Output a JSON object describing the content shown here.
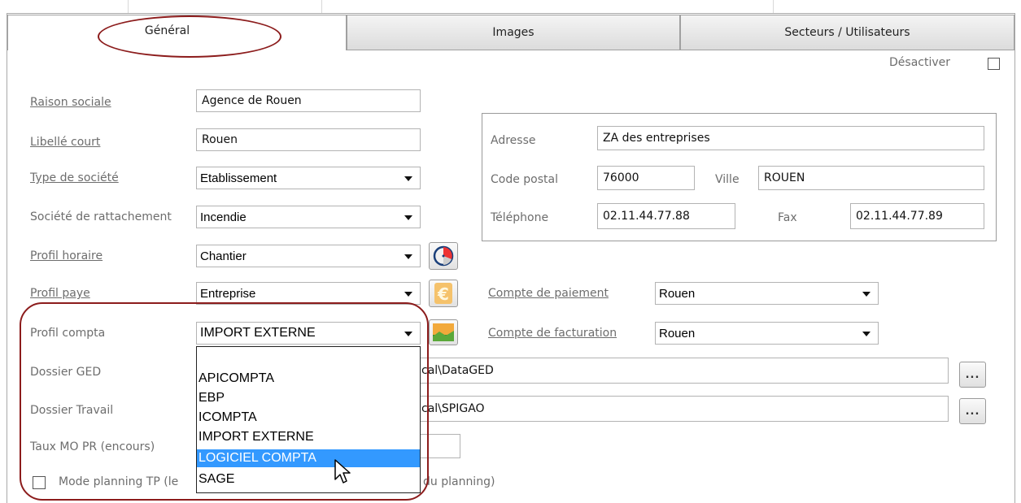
{
  "tabs": [
    {
      "label": "Général"
    },
    {
      "label": "Images"
    },
    {
      "label": "Secteurs / Utilisateurs"
    }
  ],
  "deactivate": {
    "label": "Désactiver",
    "checked": false
  },
  "fields": {
    "raison_sociale": {
      "label": "Raison sociale",
      "value": "Agence de Rouen"
    },
    "libelle_court": {
      "label": "Libellé court",
      "value": "Rouen"
    },
    "type_societe": {
      "label": "Type de société",
      "value": "Etablissement"
    },
    "societe_rattachement": {
      "label": "Société de rattachement",
      "value": "Incendie"
    },
    "profil_horaire": {
      "label": "Profil horaire",
      "value": "Chantier"
    },
    "profil_paye": {
      "label": "Profil paye",
      "value": "Entreprise"
    },
    "profil_compta": {
      "label": "Profil compta",
      "value": "IMPORT EXTERNE"
    },
    "dossier_ged": {
      "label": "Dossier GED",
      "value_visible": "cal\\DataGED"
    },
    "dossier_travail": {
      "label": "Dossier Travail",
      "value_visible": "cal\\SPIGAO"
    },
    "taux_mo": {
      "label": "Taux MO PR (encours)"
    },
    "mode_planning": {
      "label_left": "Mode planning TP (le",
      "label_right": "du planning)",
      "checked": false
    }
  },
  "address": {
    "adresse": {
      "label": "Adresse",
      "value": "ZA des entreprises"
    },
    "code_postal": {
      "label": "Code postal",
      "value": "76000"
    },
    "ville": {
      "label": "Ville",
      "value": "ROUEN"
    },
    "telephone": {
      "label": "Téléphone",
      "value": "02.11.44.77.88"
    },
    "fax": {
      "label": "Fax",
      "value": "02.11.44.77.89"
    }
  },
  "compte_paiement": {
    "label": "Compte de paiement",
    "value": "Rouen"
  },
  "compte_facturation": {
    "label": "Compte de facturation",
    "value": "Rouen"
  },
  "browse_label": "...",
  "profil_compta_options": [
    "",
    "APICOMPTA",
    "EBP",
    "ICOMPTA",
    "IMPORT EXTERNE",
    "LOGICIEL COMPTA",
    "SAGE"
  ],
  "profil_compta_highlighted": "LOGICIEL COMPTA",
  "colors": {
    "annotation": "#8c1c1c",
    "highlight": "#3399ff"
  }
}
